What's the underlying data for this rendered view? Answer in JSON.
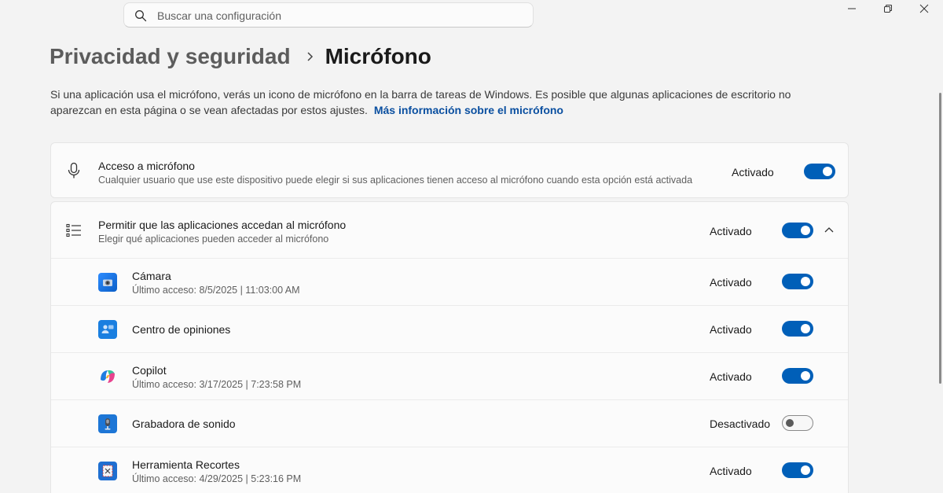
{
  "search": {
    "placeholder": "Buscar una configuración"
  },
  "breadcrumb": {
    "parent": "Privacidad y seguridad",
    "current": "Micrófono"
  },
  "description": {
    "text": "Si una aplicación usa el micrófono, verás un icono de micrófono en la barra de tareas de Windows. Es posible que algunas aplicaciones de escritorio no aparezcan en esta página o se vean afectadas por estos ajustes.",
    "link": "Más información sobre el micrófono"
  },
  "access": {
    "title": "Acceso a micrófono",
    "subtitle": "Cualquier usuario que use este dispositivo puede elegir si sus aplicaciones tienen acceso al micrófono cuando esta opción está activada",
    "status": "Activado",
    "on": true
  },
  "allow_apps": {
    "title": "Permitir que las aplicaciones accedan al micrófono",
    "subtitle": "Elegir qué aplicaciones pueden acceder al micrófono",
    "status": "Activado",
    "on": true
  },
  "apps": [
    {
      "name": "Cámara",
      "last_access": "Último acceso: 8/5/2025  |  11:03:00 AM",
      "status": "Activado",
      "on": true,
      "icon": "camera-app-icon"
    },
    {
      "name": "Centro de opiniones",
      "last_access": "",
      "status": "Activado",
      "on": true,
      "icon": "feedback-hub-icon"
    },
    {
      "name": "Copilot",
      "last_access": "Último acceso: 3/17/2025  |  7:23:58 PM",
      "status": "Activado",
      "on": true,
      "icon": "copilot-icon"
    },
    {
      "name": "Grabadora de sonido",
      "last_access": "",
      "status": "Desactivado",
      "on": false,
      "icon": "sound-recorder-icon"
    },
    {
      "name": "Herramienta Recortes",
      "last_access": "Último acceso: 4/29/2025  |  5:23:16 PM",
      "status": "Activado",
      "on": true,
      "icon": "snipping-tool-icon"
    }
  ],
  "colors": {
    "accent": "#005fb8",
    "link": "#0a4fa0"
  }
}
